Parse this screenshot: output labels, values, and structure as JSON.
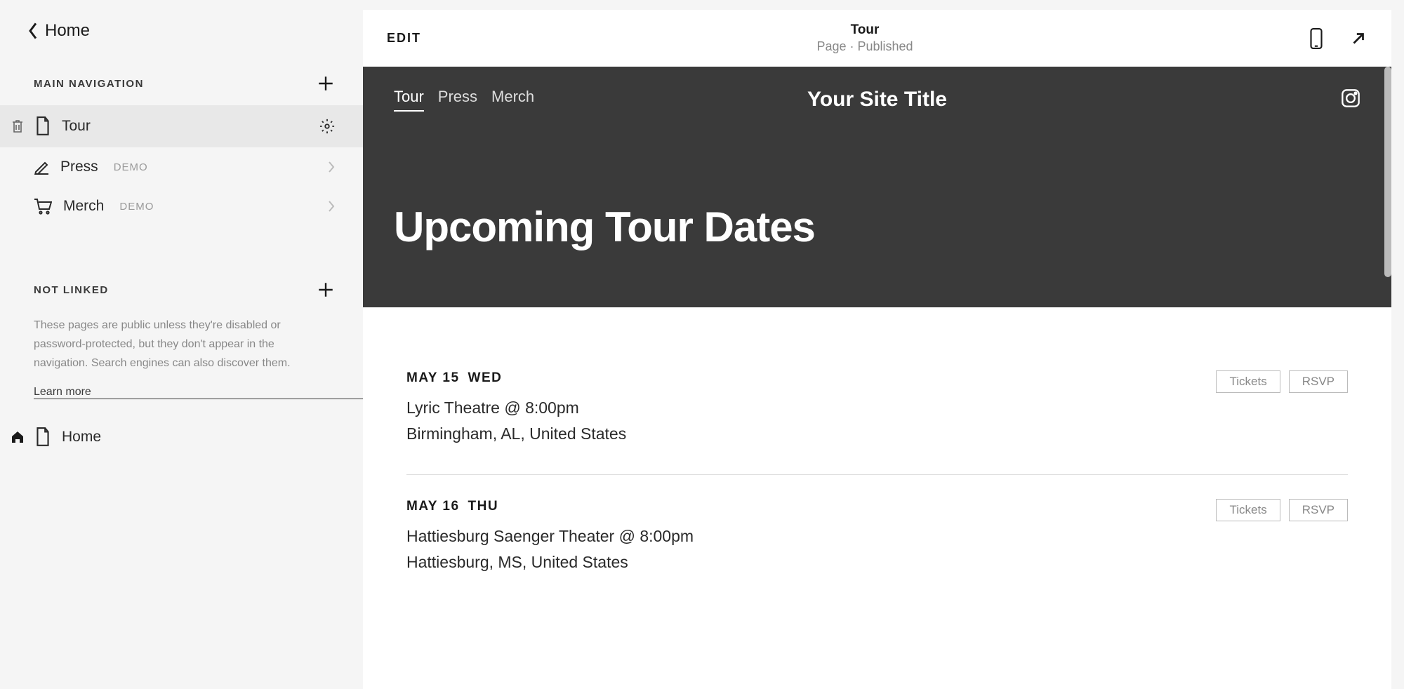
{
  "sidebar": {
    "back_label": "Home",
    "sections": {
      "main_nav": {
        "title": "MAIN NAVIGATION",
        "items": [
          {
            "label": "Tour",
            "badge": "",
            "selected": true,
            "icon": "doc"
          },
          {
            "label": "Press",
            "badge": "DEMO",
            "selected": false,
            "icon": "press"
          },
          {
            "label": "Merch",
            "badge": "DEMO",
            "selected": false,
            "icon": "cart"
          }
        ]
      },
      "not_linked": {
        "title": "NOT LINKED",
        "description": "These pages are public unless they're disabled or password-protected, but they don't appear in the navigation. Search engines can also discover them.",
        "learn_more": "Learn more",
        "items": [
          {
            "label": "Home"
          }
        ]
      }
    }
  },
  "preview_chrome": {
    "edit_label": "EDIT",
    "page_title": "Tour",
    "page_status": "Page · Published"
  },
  "site": {
    "nav": [
      "Tour",
      "Press",
      "Merch"
    ],
    "nav_active": "Tour",
    "title": "Your Site Title",
    "hero_title": "Upcoming Tour Dates",
    "tour_items": [
      {
        "date": "MAY 15",
        "day": "WED",
        "venue": "Lyric Theatre @ 8:00pm",
        "location": "Birmingham, AL, United States",
        "tickets_label": "Tickets",
        "rsvp_label": "RSVP"
      },
      {
        "date": "MAY 16",
        "day": "THU",
        "venue": "Hattiesburg Saenger Theater @ 8:00pm",
        "location": "Hattiesburg, MS, United States",
        "tickets_label": "Tickets",
        "rsvp_label": "RSVP"
      }
    ]
  }
}
